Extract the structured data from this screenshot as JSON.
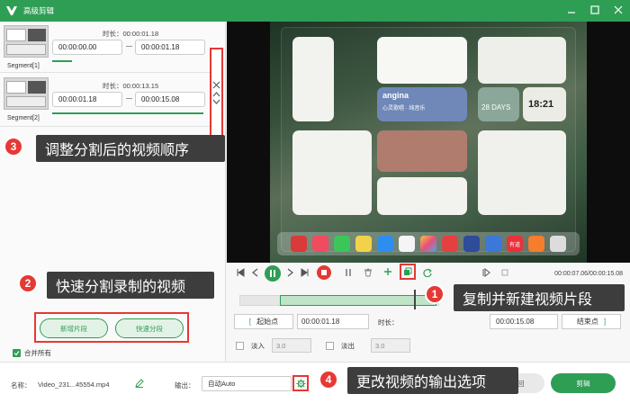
{
  "window": {
    "title": "高级剪辑"
  },
  "segments": [
    {
      "label": "Segment[1]",
      "duration_label": "时长：",
      "duration": "00:00:01.18",
      "start": "00:00:00.00",
      "end": "00:00:01.18"
    },
    {
      "label": "Segment[2]",
      "duration_label": "时长：",
      "duration": "00:00:13.15",
      "start": "00:00:01.18",
      "end": "00:00:15.08"
    }
  ],
  "annotations": {
    "a1": {
      "num": "1",
      "text": "复制并新建视频片段"
    },
    "a2": {
      "num": "2",
      "text": "快速分割录制的视频"
    },
    "a3": {
      "num": "3",
      "text": "调整分割后的视频顺序"
    },
    "a4": {
      "num": "4",
      "text": "更改视频的输出选项"
    }
  },
  "left_buttons": {
    "new_segment": "新增片段",
    "quick_split": "快速分段"
  },
  "merge": {
    "label": "合并所有",
    "checked": true
  },
  "preview": {
    "widget_tag": "angina",
    "widget_line1": "心灵歌唱 · 纯音乐",
    "widget_line2": "28 DAYS",
    "widget_clock": "18:21",
    "dock_label": "有道"
  },
  "player": {
    "time": "00:00:07.06/00:00:15.08"
  },
  "range": {
    "start_label": "起始点",
    "start_value": "00:00:01.18",
    "duration_label": "时长：",
    "end_value": "00:00:15.08",
    "end_label": "结束点"
  },
  "fade": {
    "in_label": "淡入",
    "in_value": "3.0",
    "out_label": "淡出",
    "out_value": "3.0"
  },
  "bottom": {
    "name_label": "名称：",
    "name_value": "Video_231...45554.mp4",
    "output_label": "输出：",
    "output_value": "自动Auto",
    "cancel_label": "返回",
    "cut_label": "剪辑"
  },
  "colors": {
    "accent": "#2f9e55",
    "highlight": "#e53935",
    "callout_bg": "#3d3d3d"
  }
}
